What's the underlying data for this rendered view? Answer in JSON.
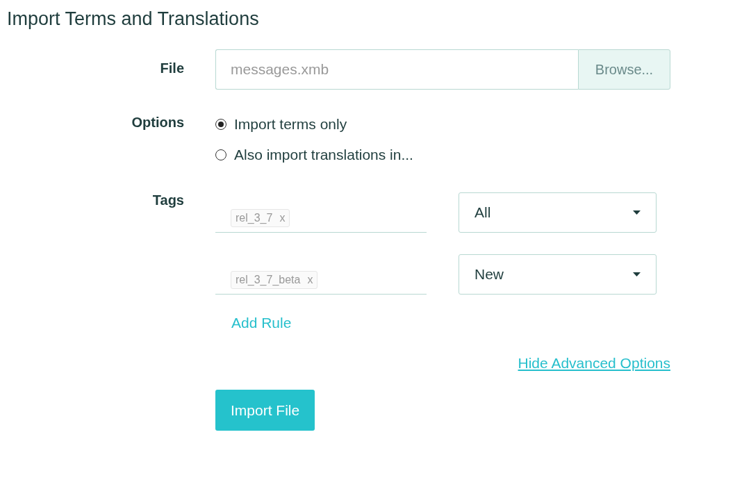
{
  "title": "Import Terms and Translations",
  "file": {
    "label": "File",
    "placeholder": "messages.xmb",
    "browse": "Browse..."
  },
  "options": {
    "label": "Options",
    "items": [
      {
        "label": "Import terms only",
        "selected": true
      },
      {
        "label": "Also import translations in...",
        "selected": false
      }
    ]
  },
  "tags": {
    "label": "Tags",
    "rules": [
      {
        "tag": "rel_3_7",
        "remove": "x",
        "select": "All"
      },
      {
        "tag": "rel_3_7_beta",
        "remove": "x",
        "select": "New"
      }
    ],
    "add_rule": "Add Rule"
  },
  "advanced_link": "Hide Advanced Options",
  "submit": "Import File"
}
